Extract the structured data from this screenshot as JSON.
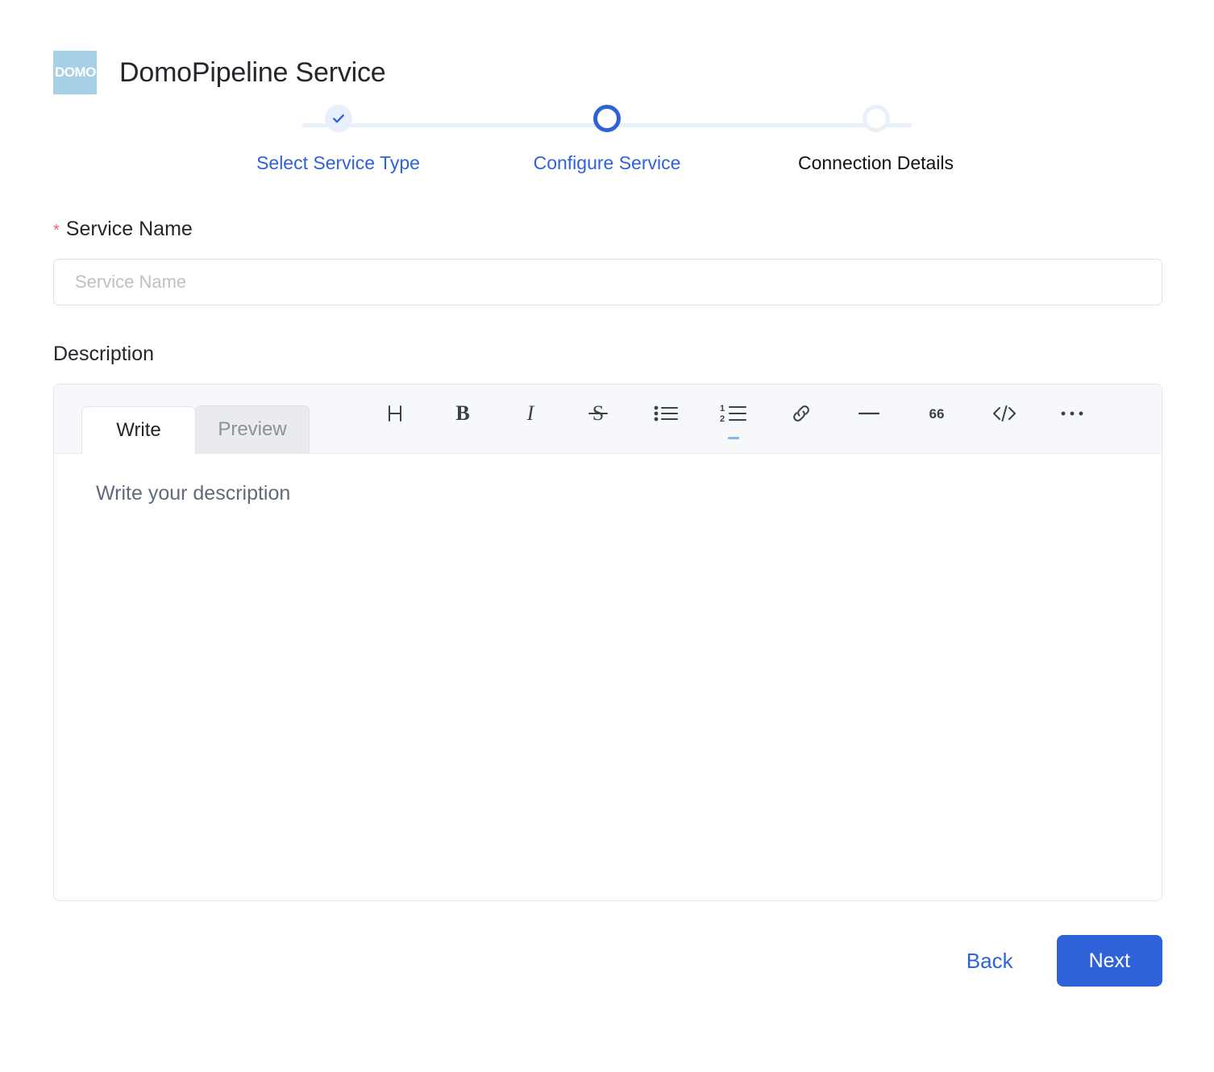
{
  "header": {
    "logo_text": "DOMO",
    "logo_icon": "domo-logo-icon",
    "title": "DomoPipeline Service"
  },
  "stepper": {
    "steps": [
      {
        "label": "Select Service Type",
        "state": "done",
        "icon": "check-icon"
      },
      {
        "label": "Configure Service",
        "state": "active",
        "icon": "circle-icon"
      },
      {
        "label": "Connection Details",
        "state": "todo",
        "icon": "circle-icon"
      }
    ]
  },
  "form": {
    "service_name": {
      "label": "Service Name",
      "required_marker": "*",
      "value": "",
      "placeholder": "Service Name"
    },
    "description": {
      "label": "Description",
      "tabs": [
        {
          "label": "Write",
          "state": "active"
        },
        {
          "label": "Preview",
          "state": "inactive"
        }
      ],
      "toolbar": [
        {
          "name": "heading-icon",
          "glyph": "H",
          "title": "Heading"
        },
        {
          "name": "bold-icon",
          "glyph": "B",
          "title": "Bold"
        },
        {
          "name": "italic-icon",
          "glyph": "I",
          "title": "Italic"
        },
        {
          "name": "strikethrough-icon",
          "glyph": "S",
          "title": "Strikethrough"
        },
        {
          "name": "bulleted-list-icon",
          "glyph": "",
          "title": "Bulleted list"
        },
        {
          "name": "numbered-list-icon",
          "glyph": "",
          "title": "Numbered list"
        },
        {
          "name": "link-icon",
          "glyph": "",
          "title": "Link"
        },
        {
          "name": "horizontal-rule-icon",
          "glyph": "",
          "title": "Horizontal rule"
        },
        {
          "name": "quote-icon",
          "glyph": "66",
          "title": "Quote"
        },
        {
          "name": "code-icon",
          "glyph": "</>",
          "title": "Code"
        },
        {
          "name": "more-options-icon",
          "glyph": "",
          "title": "More"
        }
      ],
      "editor_value": "",
      "editor_placeholder": "Write your description"
    }
  },
  "footer": {
    "back_label": "Back",
    "next_label": "Next"
  },
  "colors": {
    "accent_blue": "#2f62d9",
    "track_blue": "#e9f0fd",
    "logo_blue": "#a6cfe8",
    "required_red": "#f5656b",
    "toolbar_bg": "#f6f8fb",
    "placeholder_gray": "#bdc1c6"
  }
}
